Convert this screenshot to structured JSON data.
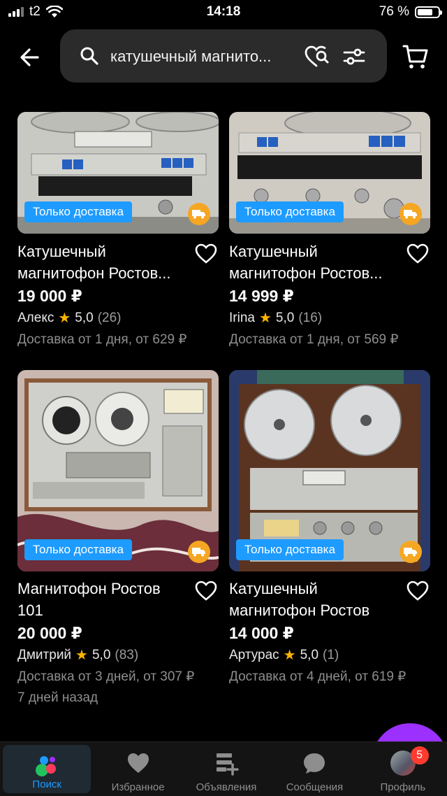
{
  "status": {
    "carrier": "t2",
    "time": "14:18",
    "battery": "76 %",
    "battery_level": 0.76
  },
  "search": {
    "query": "катушечный магнито..."
  },
  "products": [
    {
      "title": "Катушечный магнитофон Ростов...",
      "price": "19 000 ₽",
      "seller": "Алекс",
      "rating": "5,0",
      "reviews": "(26)",
      "delivery": "Доставка от 1 дня, от 629 ₽",
      "badge": "Только доставка"
    },
    {
      "title": "Катушечный магнитофон Ростов...",
      "price": "14 999 ₽",
      "seller": "Irina",
      "rating": "5,0",
      "reviews": "(16)",
      "delivery": "Доставка от 1 дня, от 569 ₽",
      "badge": "Только доставка"
    },
    {
      "title": "Магнитофон Ростов 101",
      "price": "20 000 ₽",
      "seller": "Дмитрий",
      "rating": "5,0",
      "reviews": "(83)",
      "delivery": "Доставка от 3 дней, от 307 ₽",
      "posted": "7 дней назад",
      "badge": "Только доставка"
    },
    {
      "title": "Катушечный магнитофон Ростов",
      "price": "14 000 ₽",
      "seller": "Артурас",
      "rating": "5,0",
      "reviews": "(1)",
      "delivery": "Доставка от 4 дней, от 619 ₽",
      "badge": "Только доставка"
    }
  ],
  "nav": {
    "items": [
      {
        "label": "Поиск"
      },
      {
        "label": "Избранное"
      },
      {
        "label": "Объявления"
      },
      {
        "label": "Сообщения"
      },
      {
        "label": "Профиль"
      }
    ],
    "profile_badge": "5"
  },
  "colors": {
    "accent": "#1e9bff",
    "badge_bg": "#1e9bff",
    "star": "#ffb400",
    "truck": "#f5a623",
    "fab": "#9b30ff",
    "notification": "#ff3b30"
  }
}
